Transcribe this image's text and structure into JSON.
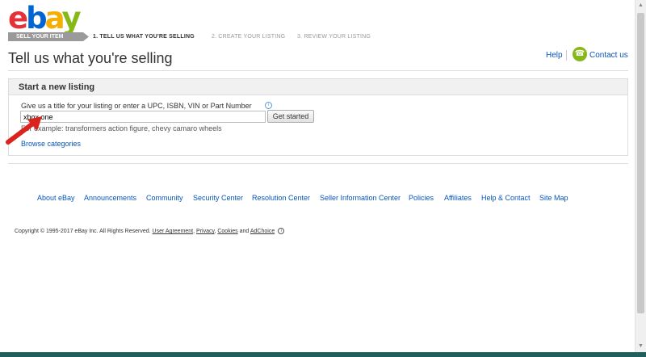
{
  "logo": {
    "e": "e",
    "b": "b",
    "a": "a",
    "y": "y"
  },
  "steps": {
    "current_badge": "SELL YOUR ITEM",
    "step1": "1. TELL US WHAT YOU'RE SELLING",
    "step2": "2. CREATE YOUR LISTING",
    "step3": "3. REVIEW YOUR LISTING"
  },
  "page_title": "Tell us what you're selling",
  "header_links": {
    "help": "Help",
    "contact": "Contact us",
    "contact_icon": "phone-icon"
  },
  "listing": {
    "heading": "Start a new listing",
    "prompt": "Give us a title for your listing or enter a UPC, ISBN, VIN or Part Number",
    "info_icon": "i",
    "input_value": "xbox one",
    "button_label": "Get started",
    "example": "For example: transformers action figure, chevy camaro wheels",
    "browse_link": "Browse categories"
  },
  "footer": {
    "links": [
      "About eBay",
      "Announcements",
      "Community",
      "Security Center",
      "Resolution Center",
      "Seller Information Center",
      "Policies",
      "Affiliates",
      "Help & Contact",
      "Site Map"
    ],
    "copyright_text": "Copyright © 1995-2017 eBay Inc. All Rights Reserved.",
    "user_agreement": "User Agreement",
    "privacy": "Privacy",
    "cookies": "Cookies",
    "and": "and",
    "adchoice": "AdChoice",
    "adchoice_icon": "i"
  },
  "colors": {
    "link": "#0654ba",
    "annotation_arrow": "#d9231c",
    "contact_icon": "#86b817"
  }
}
